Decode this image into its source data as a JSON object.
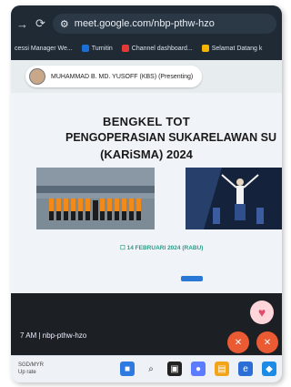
{
  "browser": {
    "url": "meet.google.com/nbp-pthw-hzo",
    "bookmarks": [
      {
        "label": "cessi Manager We...",
        "color": "#5f6b78"
      },
      {
        "label": "Turnitin",
        "color": "#1b6ed6"
      },
      {
        "label": "Channel dashboard...",
        "color": "#e53935"
      },
      {
        "label": "Selamat Datang k",
        "color": "#f4b400"
      }
    ]
  },
  "presenter": {
    "label": "MUHAMMAD B. MD. YUSOFF (KBS) (Presenting)"
  },
  "slide": {
    "title_line1": "BENGKEL TOT",
    "title_line2": "PENGOPERASIAN SUKARELAWAN SU",
    "title_line3": "(KARiSMA) 2024",
    "date": "14 FEBRUARI 2024 (RABU)"
  },
  "meeting": {
    "time_code": "7 AM",
    "code": "nbp-pthw-hzo"
  },
  "taskbar": {
    "ticker_symbol": "SGD/MYR",
    "ticker_note": "Up rate"
  },
  "colors": {
    "accent_red": "#ea5b34",
    "heart_bg": "#ffd7db",
    "date_color": "#2c9c88"
  }
}
